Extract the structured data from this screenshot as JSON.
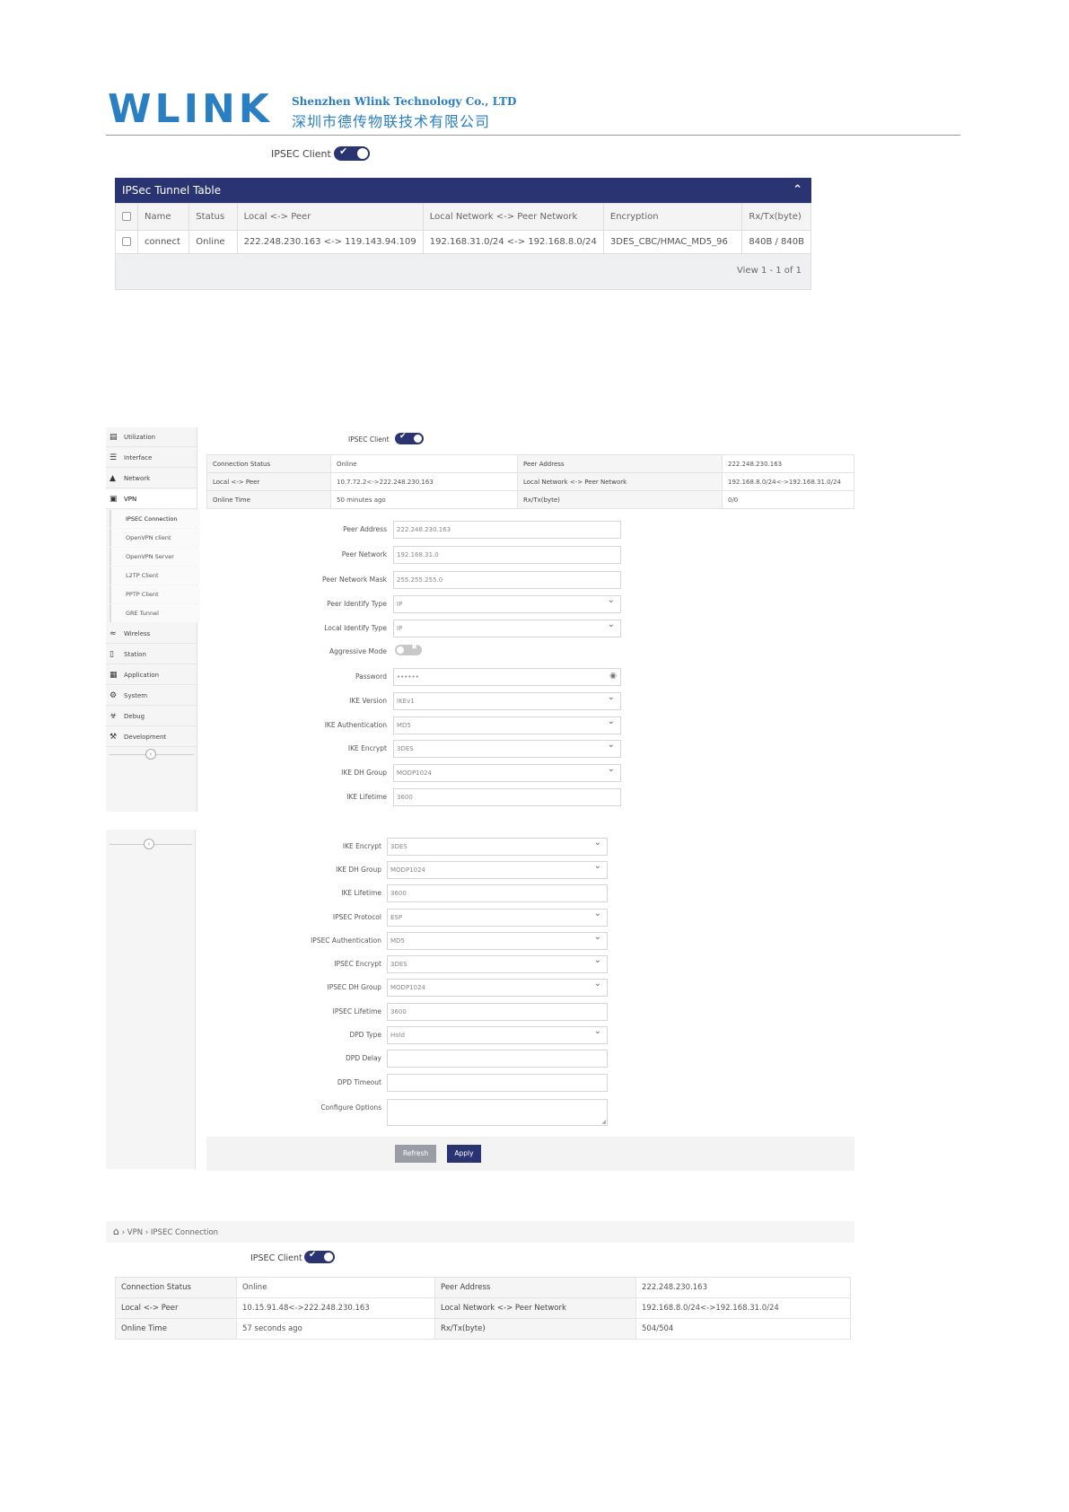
{
  "header": {
    "logo_text": "WLINK",
    "company_en": "Shenzhen Wlink Technology Co., LTD",
    "company_cn": "深圳市德传物联技术有限公司"
  },
  "section1": {
    "toggle_label": "IPSEC Client",
    "table_title": "IPSec Tunnel Table",
    "columns": [
      "Name",
      "Status",
      "Local <-> Peer",
      "Local Network <-> Peer Network",
      "Encryption",
      "Rx/Tx(byte)"
    ],
    "rows": [
      [
        "connect",
        "Online",
        "222.248.230.163 <-> 119.143.94.109",
        "192.168.31.0/24 <-> 192.168.8.0/24",
        "3DES_CBC/HMAC_MD5_96",
        "840B / 840B"
      ]
    ],
    "pager": "View 1 - 1 of 1"
  },
  "sidebar": {
    "items": [
      "Utilization",
      "Interface",
      "Network",
      "VPN"
    ],
    "vpn_sub": [
      "IPSEC Connection",
      "OpenVPN client",
      "OpenVPN Server",
      "L2TP Client",
      "PPTP Client",
      "GRE Tunnel"
    ],
    "items_after": [
      "Wireless",
      "Station",
      "Application",
      "System",
      "Debug",
      "Development"
    ]
  },
  "section2": {
    "toggle_label": "IPSEC Client",
    "status": [
      [
        "Connection Status",
        "Online",
        "Peer Address",
        "222.248.230.163"
      ],
      [
        "Local <-> Peer",
        "10.7.72.2<->222.248.230.163",
        "Local Network <-> Peer Network",
        "192.168.8.0/24<->192.168.31.0/24"
      ],
      [
        "Online Time",
        "50 minutes ago",
        "Rx/Tx(byte)",
        "0/0"
      ]
    ],
    "form": {
      "peer_address": {
        "label": "Peer Address",
        "value": "222.248.230.163"
      },
      "peer_network": {
        "label": "Peer Network",
        "value": "192.168.31.0"
      },
      "peer_network_mask": {
        "label": "Peer Network Mask",
        "value": "255.255.255.0"
      },
      "peer_identify_type": {
        "label": "Peer Identify Type",
        "value": "IP"
      },
      "local_identify_type": {
        "label": "Local Identify Type",
        "value": "IP"
      },
      "aggressive_mode": {
        "label": "Aggressive Mode"
      },
      "password": {
        "label": "Password",
        "value": "••••••"
      },
      "ike_version": {
        "label": "IKE Version",
        "value": "IKEv1"
      },
      "ike_authentication": {
        "label": "IKE Authentication",
        "value": "MD5"
      },
      "ike_encrypt": {
        "label": "IKE Encrypt",
        "value": "3DES"
      },
      "ike_dh_group": {
        "label": "IKE DH Group",
        "value": "MODP1024"
      },
      "ike_lifetime": {
        "label": "IKE Lifetime",
        "value": "3600"
      }
    }
  },
  "section3": {
    "form": {
      "ike_encrypt": {
        "label": "IKE Encrypt",
        "value": "3DES"
      },
      "ike_dh_group": {
        "label": "IKE DH Group",
        "value": "MODP1024"
      },
      "ike_lifetime": {
        "label": "IKE Lifetime",
        "value": "3600"
      },
      "ipsec_protocol": {
        "label": "IPSEC Protocol",
        "value": "ESP"
      },
      "ipsec_authentication": {
        "label": "IPSEC Authentication",
        "value": "MD5"
      },
      "ipsec_encrypt": {
        "label": "IPSEC Encrypt",
        "value": "3DES"
      },
      "ipsec_dh_group": {
        "label": "IPSEC DH Group",
        "value": "MODP1024"
      },
      "ipsec_lifetime": {
        "label": "IPSEC Lifetime",
        "value": "3600"
      },
      "dpd_type": {
        "label": "DPD Type",
        "value": "Hold"
      },
      "dpd_delay": {
        "label": "DPD Delay",
        "value": ""
      },
      "dpd_timeout": {
        "label": "DPD Timeout",
        "value": ""
      },
      "configure_options": {
        "label": "Configure Options",
        "value": ""
      }
    },
    "refresh_label": "Refresh",
    "apply_label": "Apply"
  },
  "section4": {
    "breadcrumb": [
      "VPN",
      "IPSEC Connection"
    ],
    "toggle_label": "IPSEC Client",
    "status": [
      [
        "Connection Status",
        "Online",
        "Peer Address",
        "222.248.230.163"
      ],
      [
        "Local <-> Peer",
        "10.15.91.48<->222.248.230.163",
        "Local Network <-> Peer Network",
        "192.168.8.0/24<->192.168.31.0/24"
      ],
      [
        "Online Time",
        "57 seconds ago",
        "Rx/Tx(byte)",
        "504/504"
      ]
    ]
  },
  "colors": {
    "brand_blue": "#2a7fc2",
    "navy": "#2a3472",
    "button_gray": "#9a9da3"
  }
}
